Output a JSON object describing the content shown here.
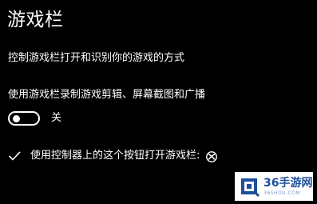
{
  "page": {
    "title": "游戏栏",
    "description": "控制游戏栏打开和识别你的游戏的方式"
  },
  "record_setting": {
    "label": "使用游戏栏录制游戏剪辑、屏幕截图和广播",
    "toggle_state": "关",
    "toggle_on": false
  },
  "controller_setting": {
    "label": "使用控制器上的这个按钮打开游戏栏:",
    "checked": true,
    "icon": "xbox-logo-icon"
  },
  "watermark": {
    "brand": "36手游网",
    "url": "36SHOU.COM",
    "colors": {
      "primary": "#1d4f9c",
      "secondary": "#7e9cc7"
    }
  }
}
